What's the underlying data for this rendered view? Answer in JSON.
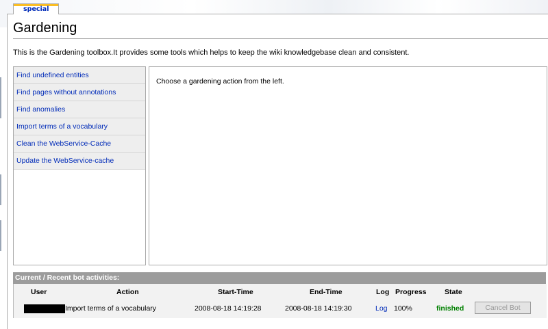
{
  "tab": {
    "label": "special"
  },
  "page": {
    "title": "Gardening",
    "intro": "This is the Gardening toolbox.It provides some tools which helps to keep the wiki knowledgebase clean and consistent."
  },
  "menu": {
    "items": [
      {
        "label": "Find undefined entities"
      },
      {
        "label": "Find pages without annotations"
      },
      {
        "label": "Find anomalies"
      },
      {
        "label": "Import terms of a vocabulary"
      },
      {
        "label": "Clean the WebService-Cache"
      },
      {
        "label": "Update the WebService-cache"
      }
    ]
  },
  "panel": {
    "message": "Choose a gardening action from the left."
  },
  "bot_activities": {
    "header": "Current / Recent bot activities:",
    "columns": [
      "User",
      "Action",
      "Start-Time",
      "End-Time",
      "Log",
      "Progress",
      "State"
    ],
    "rows": [
      {
        "user": "",
        "action": "Import terms of a vocabulary",
        "start_time": "2008-08-18 14:19:28",
        "end_time": "2008-08-18 14:19:30",
        "log": "Log",
        "progress": "100%",
        "state": "finished",
        "cancel_label": "Cancel Bot"
      }
    ]
  },
  "colors": {
    "link": "#002bb8",
    "state_finished": "#008000",
    "header_bg": "#9c9c9c"
  }
}
